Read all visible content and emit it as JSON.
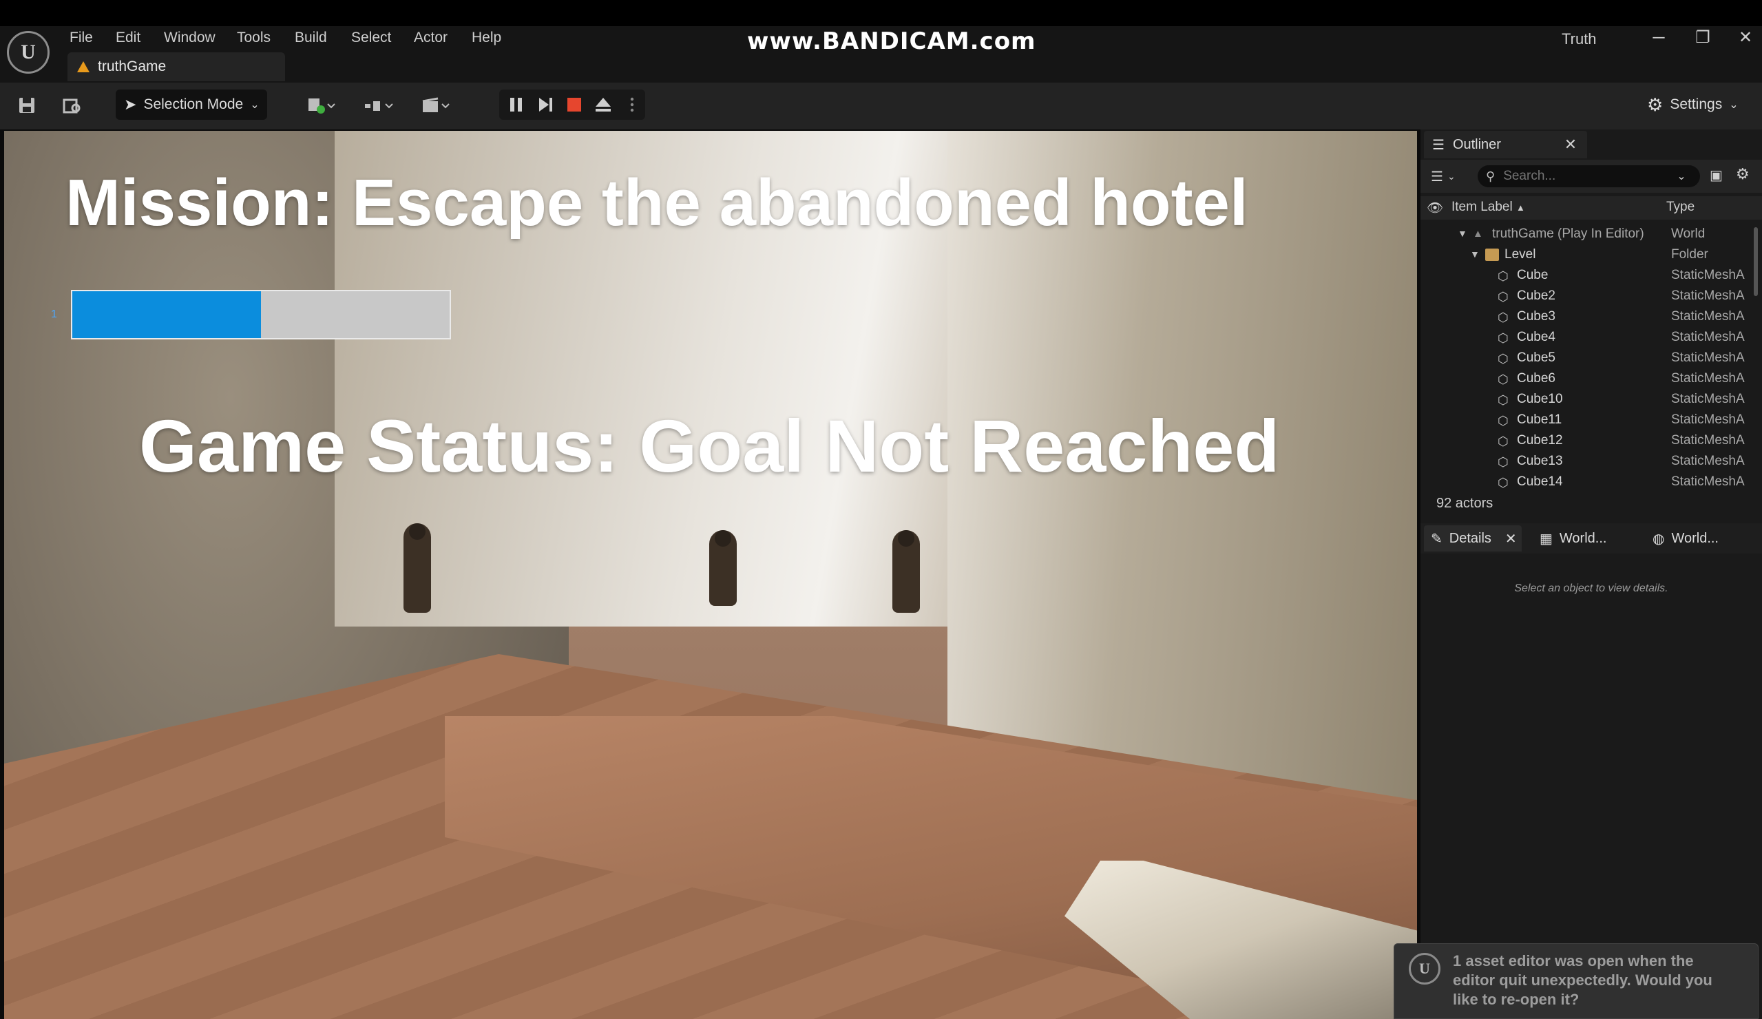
{
  "menu": {
    "items": [
      "File",
      "Edit",
      "Window",
      "Tools",
      "Build",
      "Select",
      "Actor",
      "Help"
    ]
  },
  "watermark": "www.BANDICAM.com",
  "window": {
    "project_name": "Truth",
    "level_tab": "truthGame"
  },
  "toolbar": {
    "selection_mode": "Selection Mode",
    "settings": "Settings"
  },
  "game_hud": {
    "mission": "Mission: Escape the abandoned hotel",
    "status": "Game Status: Goal Not Reached",
    "progress_fraction": 0.5,
    "progress_color": "#0b8ddd",
    "fps_marker": "1"
  },
  "outliner": {
    "title": "Outliner",
    "search_placeholder": "Search...",
    "columns": {
      "label": "Item Label",
      "type": "Type"
    },
    "rows": [
      {
        "name": "truthGame (Play In Editor)",
        "type": "World",
        "depth": 0,
        "icon": "world-icon"
      },
      {
        "name": "Level",
        "type": "Folder",
        "depth": 1,
        "icon": "folder-icon"
      },
      {
        "name": "Cube",
        "type": "StaticMeshA",
        "depth": 2,
        "icon": "static-mesh-icon"
      },
      {
        "name": "Cube2",
        "type": "StaticMeshA",
        "depth": 2,
        "icon": "static-mesh-icon"
      },
      {
        "name": "Cube3",
        "type": "StaticMeshA",
        "depth": 2,
        "icon": "static-mesh-icon"
      },
      {
        "name": "Cube4",
        "type": "StaticMeshA",
        "depth": 2,
        "icon": "static-mesh-icon"
      },
      {
        "name": "Cube5",
        "type": "StaticMeshA",
        "depth": 2,
        "icon": "static-mesh-icon"
      },
      {
        "name": "Cube6",
        "type": "StaticMeshA",
        "depth": 2,
        "icon": "static-mesh-icon"
      },
      {
        "name": "Cube10",
        "type": "StaticMeshA",
        "depth": 2,
        "icon": "static-mesh-icon"
      },
      {
        "name": "Cube11",
        "type": "StaticMeshA",
        "depth": 2,
        "icon": "static-mesh-icon"
      },
      {
        "name": "Cube12",
        "type": "StaticMeshA",
        "depth": 2,
        "icon": "static-mesh-icon"
      },
      {
        "name": "Cube13",
        "type": "StaticMeshA",
        "depth": 2,
        "icon": "static-mesh-icon"
      },
      {
        "name": "Cube14",
        "type": "StaticMeshA",
        "depth": 2,
        "icon": "static-mesh-icon"
      }
    ],
    "actor_count": "92 actors"
  },
  "details": {
    "tabs": [
      "Details",
      "World...",
      "World..."
    ],
    "empty_message": "Select an object to view details."
  },
  "toast": {
    "message": "1 asset editor was open when the editor quit unexpectedly. Would you like to re-open it?"
  }
}
